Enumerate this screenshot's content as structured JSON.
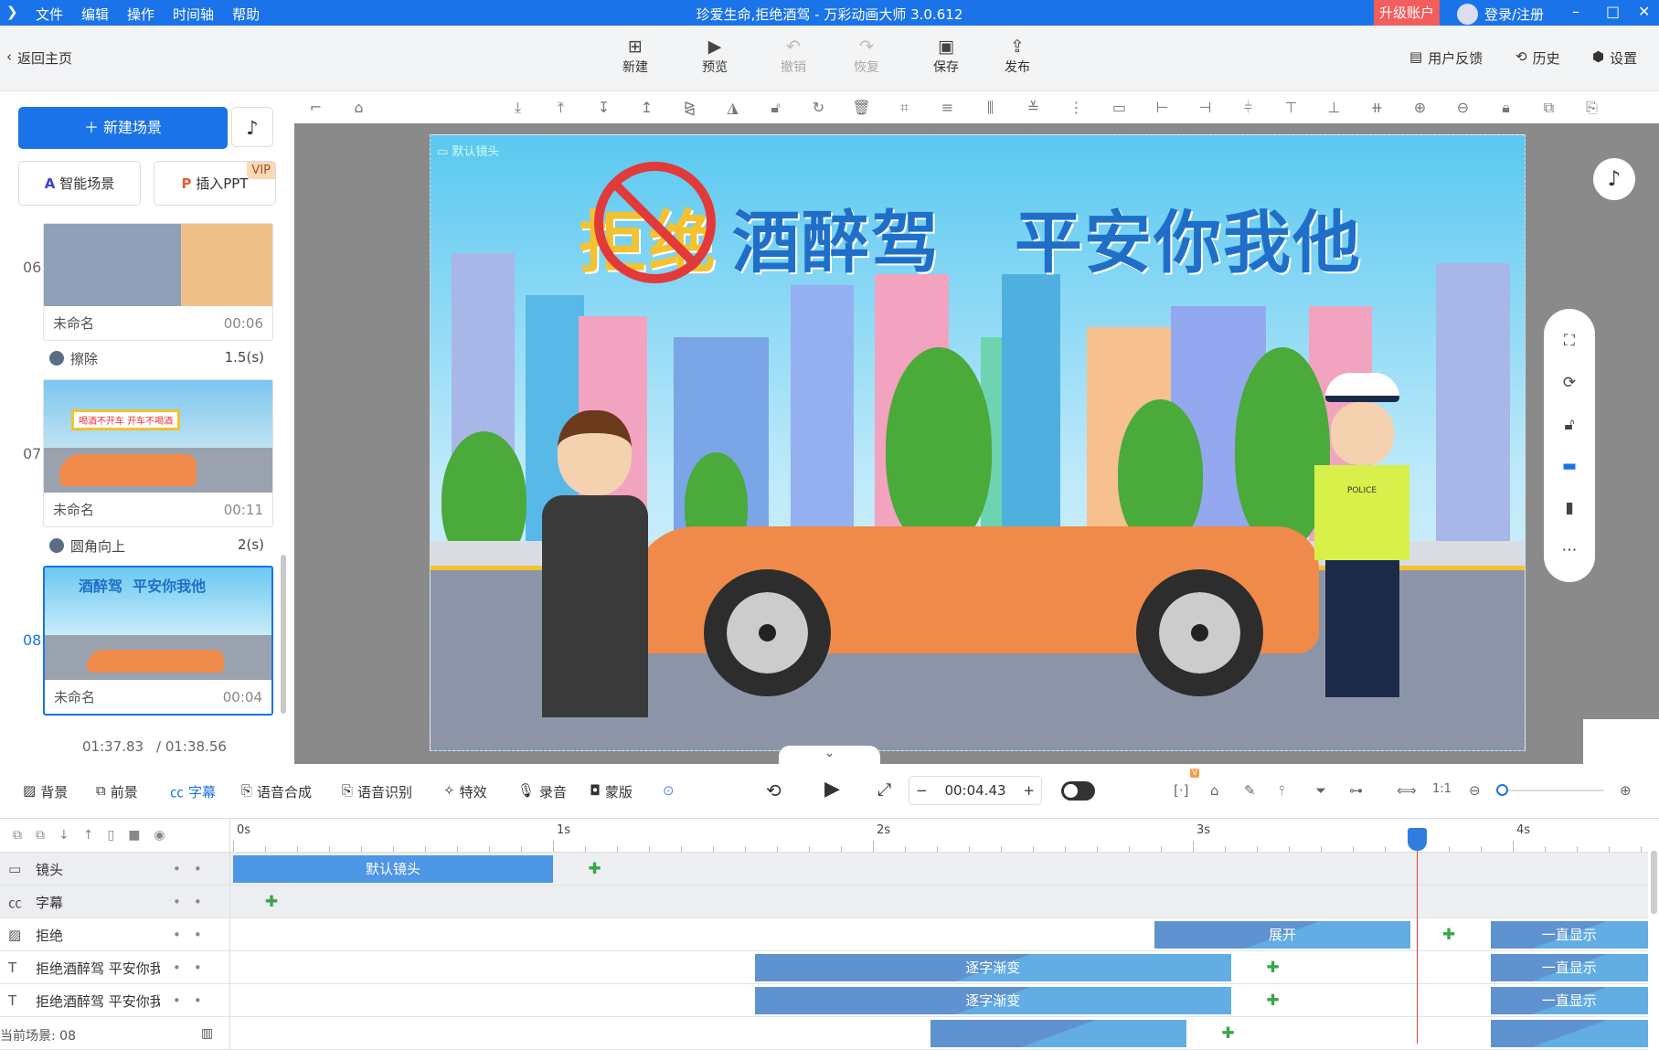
{
  "titlebar": {
    "menu": [
      "文件",
      "编辑",
      "操作",
      "时间轴",
      "帮助"
    ],
    "title": "珍爱生命,拒绝酒驾 - 万彩动画大师 3.0.612",
    "upgrade": "升级账户",
    "login": "登录/注册"
  },
  "topbar": {
    "back": "返回主页",
    "buttons": [
      {
        "label": "新建",
        "icon": "new-icon"
      },
      {
        "label": "预览",
        "icon": "play-icon"
      },
      {
        "label": "撤销",
        "icon": "undo-icon"
      },
      {
        "label": "恢复",
        "icon": "redo-icon"
      },
      {
        "label": "保存",
        "icon": "save-icon"
      },
      {
        "label": "发布",
        "icon": "publish-icon"
      }
    ],
    "feedback": "用户反馈",
    "history": "历史",
    "settings": "设置"
  },
  "left": {
    "new_scene": "新建场景",
    "smart_scene": "智能场景",
    "insert_ppt": "插入PPT",
    "vip": "VIP",
    "scenes": [
      {
        "num": "06",
        "name": "未命名",
        "duration": "00:06"
      },
      {
        "num": "07",
        "name": "未命名",
        "duration": "00:11"
      },
      {
        "num": "08",
        "name": "未命名",
        "duration": "00:04",
        "selected": true
      }
    ],
    "transitions": [
      {
        "name": "擦除",
        "duration": "1.5(s)"
      },
      {
        "name": "圆角向上",
        "duration": "2(s)"
      }
    ],
    "current_time": "01:37.83",
    "total_time": "/ 01:38.56",
    "current_scene": "当前场景: 08"
  },
  "canvas": {
    "camera_label": "默认镜头",
    "headline_a": "拒绝",
    "headline_b": "酒醉驾",
    "headline_c": "平安你我他",
    "thumb7_banner": "喝酒不开车  开车不喝酒",
    "police_badge": "POLICE"
  },
  "timeline_toolbar": {
    "items": [
      "背景",
      "前景",
      "字幕",
      "语音合成",
      "语音识别",
      "特效",
      "录音",
      "蒙版"
    ],
    "active": "字幕",
    "time": "00:04.43",
    "vip_badge": "V"
  },
  "timeline": {
    "ticks": [
      "0s",
      "1s",
      "2s",
      "3s",
      "4s"
    ],
    "playhead_s": 3.7,
    "tracks": [
      {
        "name": "镜头",
        "icon": "camera-icon",
        "clips": [
          {
            "label": "默认镜头",
            "start": 0,
            "end": 1.0,
            "solid": true
          }
        ],
        "keyframes": [
          1.13
        ]
      },
      {
        "name": "字幕",
        "icon": "subtitle-icon",
        "clips": [],
        "keyframes": [
          0.12
        ]
      },
      {
        "name": "拒绝",
        "icon": "image-icon",
        "clips": [
          {
            "label": "展开",
            "start": 2.88,
            "end": 3.68
          },
          {
            "label": "一直显示",
            "start": 3.93,
            "end": 4.43
          }
        ],
        "keyframes": [
          3.8
        ]
      },
      {
        "name": "拒绝酒醉驾 平安你我",
        "icon": "text-icon",
        "clips": [
          {
            "label": "逐字渐变",
            "start": 1.63,
            "end": 3.12
          },
          {
            "label": "一直显示",
            "start": 3.93,
            "end": 4.43
          }
        ],
        "keyframes": [
          3.25
        ]
      },
      {
        "name": "拒绝酒醉驾 平安你我",
        "icon": "text-icon",
        "clips": [
          {
            "label": "逐字渐变",
            "start": 1.63,
            "end": 3.12
          },
          {
            "label": "一直显示",
            "start": 3.93,
            "end": 4.43
          }
        ],
        "keyframes": [
          3.25
        ]
      },
      {
        "name": "",
        "icon": "",
        "clips": [
          {
            "label": "",
            "start": 2.18,
            "end": 2.98
          },
          {
            "label": "",
            "start": 3.93,
            "end": 4.43
          }
        ],
        "keyframes": [
          3.11
        ]
      }
    ]
  },
  "colors": {
    "accent": "#1a73e8",
    "upgrade": "#f25d5d",
    "playhead": "#e04040",
    "keyframe": "#3aa54a"
  }
}
